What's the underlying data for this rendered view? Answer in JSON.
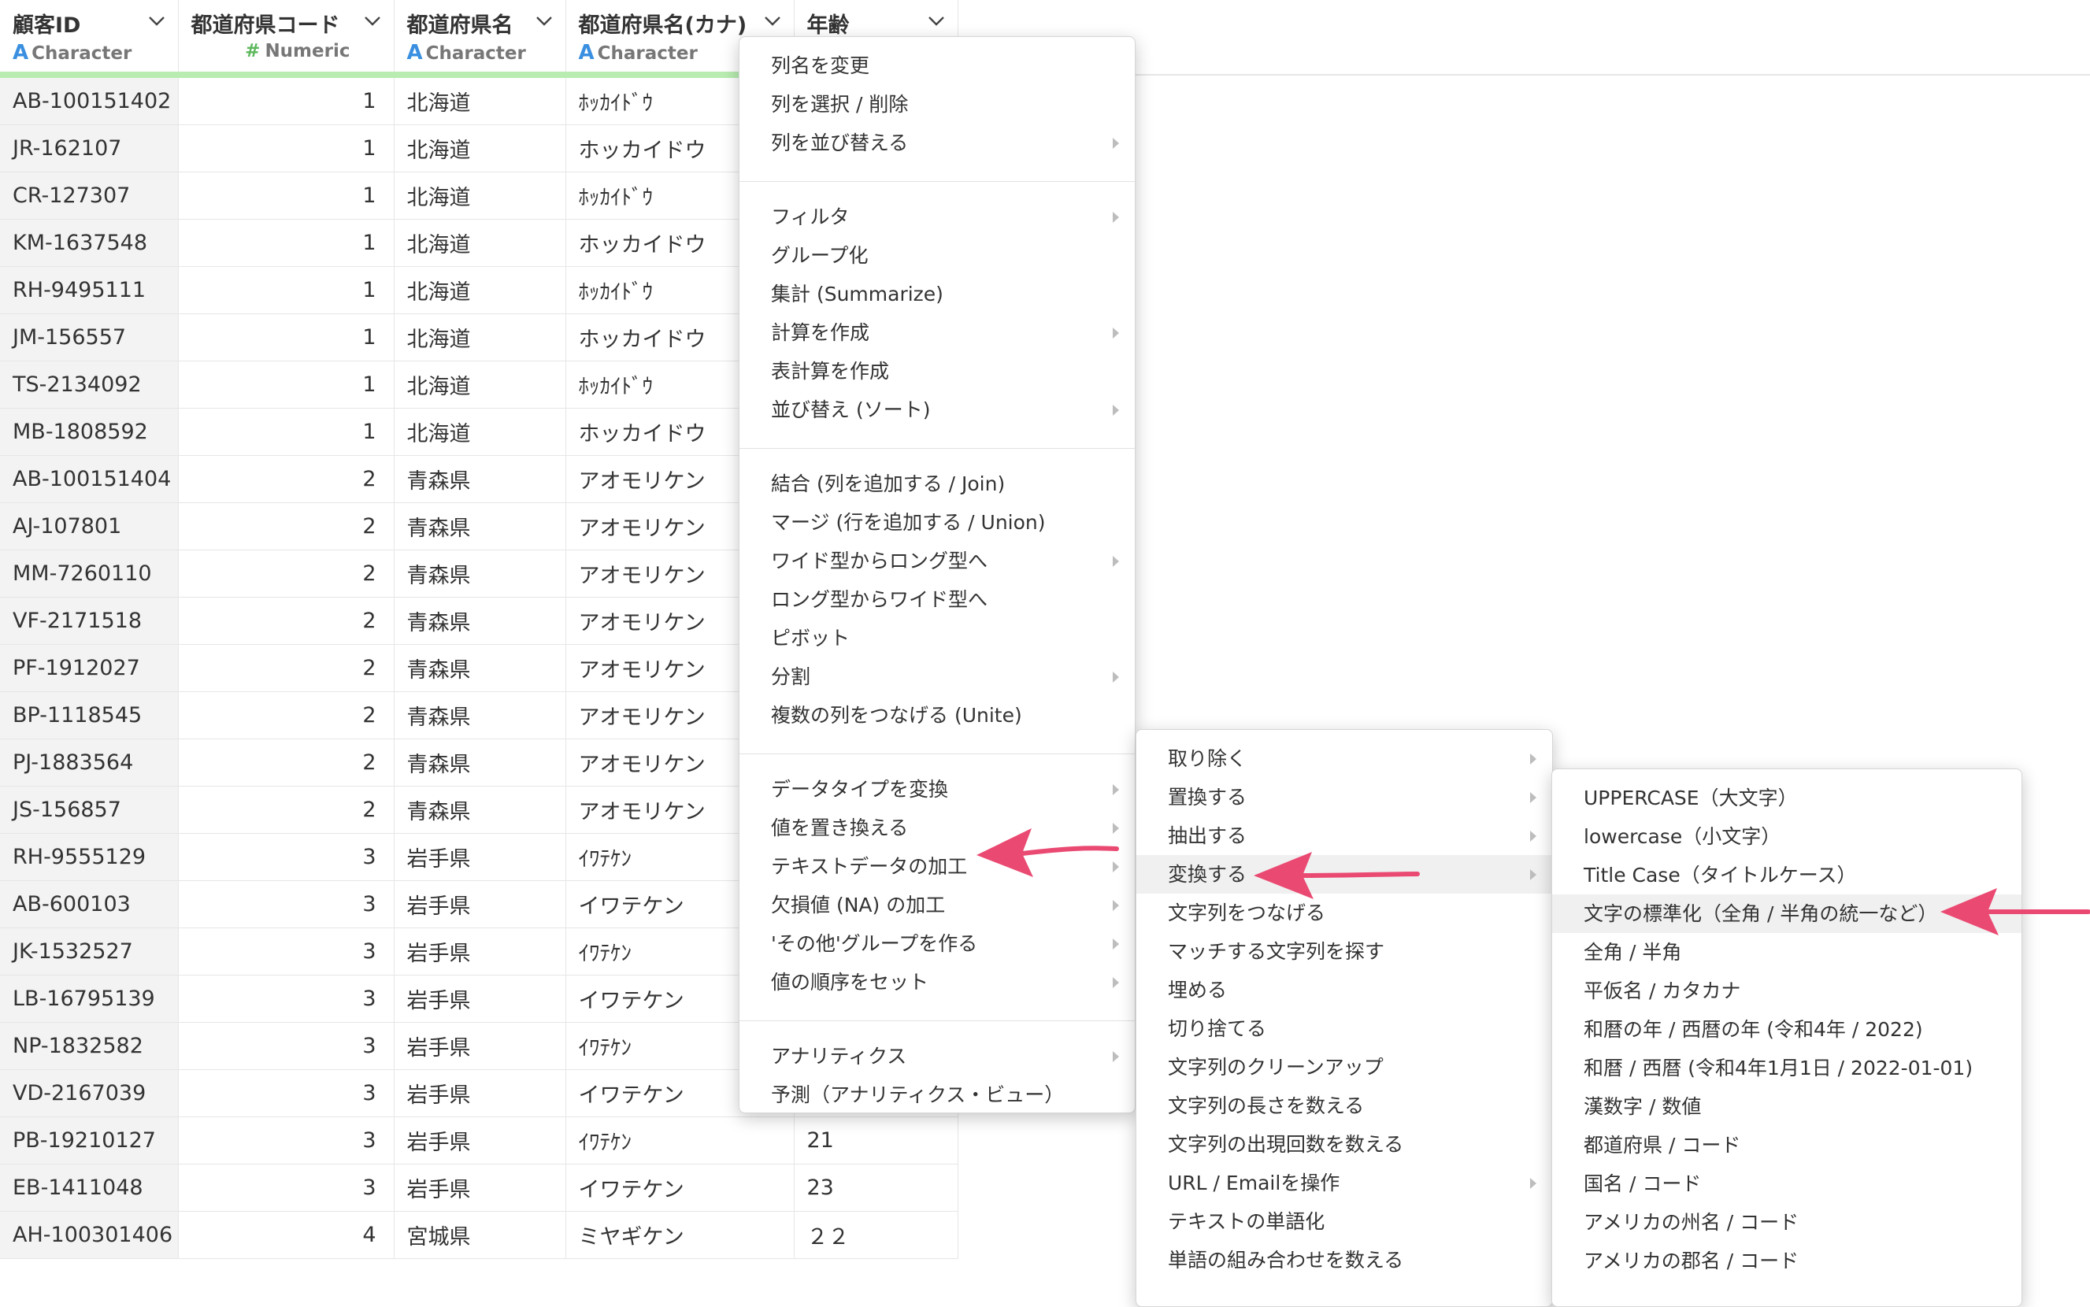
{
  "columns": [
    {
      "name": "顧客ID",
      "type": "Character",
      "type_icon": "A"
    },
    {
      "name": "都道府県コード",
      "type": "Numeric",
      "type_icon": "#"
    },
    {
      "name": "都道府県名",
      "type": "Character",
      "type_icon": "A"
    },
    {
      "name": "都道府県名(カナ)",
      "type": "Character",
      "type_icon": "A"
    },
    {
      "name": "年齢",
      "type": "",
      "type_icon": ""
    }
  ],
  "rows": [
    [
      "AB-100151402",
      "1",
      "北海道",
      "ﾎｯｶｲﾄﾞｳ",
      ""
    ],
    [
      "JR-162107",
      "1",
      "北海道",
      "ホッカイドウ",
      ""
    ],
    [
      "CR-127307",
      "1",
      "北海道",
      "ﾎｯｶｲﾄﾞｳ",
      ""
    ],
    [
      "KM-1637548",
      "1",
      "北海道",
      "ホッカイドウ",
      ""
    ],
    [
      "RH-9495111",
      "1",
      "北海道",
      "ﾎｯｶｲﾄﾞｳ",
      ""
    ],
    [
      "JM-156557",
      "1",
      "北海道",
      "ホッカイドウ",
      ""
    ],
    [
      "TS-2134092",
      "1",
      "北海道",
      "ﾎｯｶｲﾄﾞｳ",
      ""
    ],
    [
      "MB-1808592",
      "1",
      "北海道",
      "ホッカイドウ",
      ""
    ],
    [
      "AB-100151404",
      "2",
      "青森県",
      "アオモリケン",
      ""
    ],
    [
      "AJ-107801",
      "2",
      "青森県",
      "アオモリケン",
      ""
    ],
    [
      "MM-7260110",
      "2",
      "青森県",
      "アオモリケン",
      ""
    ],
    [
      "VF-2171518",
      "2",
      "青森県",
      "アオモリケン",
      ""
    ],
    [
      "PF-1912027",
      "2",
      "青森県",
      "アオモリケン",
      ""
    ],
    [
      "BP-1118545",
      "2",
      "青森県",
      "アオモリケン",
      ""
    ],
    [
      "PJ-1883564",
      "2",
      "青森県",
      "アオモリケン",
      ""
    ],
    [
      "JS-156857",
      "2",
      "青森県",
      "アオモリケン",
      ""
    ],
    [
      "RH-9555129",
      "3",
      "岩手県",
      "ｲﾜﾃｹﾝ",
      ""
    ],
    [
      "AB-600103",
      "3",
      "岩手県",
      "イワテケン",
      ""
    ],
    [
      "JK-1532527",
      "3",
      "岩手県",
      "ｲﾜﾃｹﾝ",
      ""
    ],
    [
      "LB-16795139",
      "3",
      "岩手県",
      "イワテケン",
      ""
    ],
    [
      "NP-1832582",
      "3",
      "岩手県",
      "ｲﾜﾃｹﾝ",
      ""
    ],
    [
      "VD-2167039",
      "3",
      "岩手県",
      "イワテケン",
      ""
    ],
    [
      "PB-19210127",
      "3",
      "岩手県",
      "ｲﾜﾃｹﾝ",
      "21"
    ],
    [
      "EB-1411048",
      "3",
      "岩手県",
      "イワテケン",
      "23"
    ],
    [
      "AH-100301406",
      "4",
      "宮城県",
      "ミヤギケン",
      "２２"
    ]
  ],
  "menu1": {
    "groups": [
      [
        {
          "label": "列名を変更",
          "sub": false
        },
        {
          "label": "列を選択 / 削除",
          "sub": false
        },
        {
          "label": "列を並び替える",
          "sub": true
        }
      ],
      [
        {
          "label": "フィルタ",
          "sub": true
        },
        {
          "label": "グループ化",
          "sub": false
        },
        {
          "label": "集計 (Summarize)",
          "sub": false
        },
        {
          "label": "計算を作成",
          "sub": true
        },
        {
          "label": "表計算を作成",
          "sub": false
        },
        {
          "label": "並び替え (ソート)",
          "sub": true
        }
      ],
      [
        {
          "label": "結合 (列を追加する / Join)",
          "sub": false
        },
        {
          "label": "マージ (行を追加する / Union)",
          "sub": false
        },
        {
          "label": "ワイド型からロング型へ",
          "sub": true
        },
        {
          "label": "ロング型からワイド型へ",
          "sub": false
        },
        {
          "label": "ピボット",
          "sub": false
        },
        {
          "label": "分割",
          "sub": true
        },
        {
          "label": "複数の列をつなげる (Unite)",
          "sub": false
        }
      ],
      [
        {
          "label": "データタイプを変換",
          "sub": true
        },
        {
          "label": "値を置き換える",
          "sub": true
        },
        {
          "label": "テキストデータの加工",
          "sub": true
        },
        {
          "label": "欠損値 (NA) の加工",
          "sub": true
        },
        {
          "label": "'その他'グループを作る",
          "sub": true
        },
        {
          "label": "値の順序をセット",
          "sub": true
        }
      ],
      [
        {
          "label": "アナリティクス",
          "sub": true
        },
        {
          "label": "予測（アナリティクス・ビュー）",
          "sub": false
        }
      ]
    ]
  },
  "menu2": {
    "items": [
      {
        "label": "取り除く",
        "sub": true
      },
      {
        "label": "置換する",
        "sub": true
      },
      {
        "label": "抽出する",
        "sub": true
      },
      {
        "label": "変換する",
        "sub": true,
        "highlight": true
      },
      {
        "label": "文字列をつなげる",
        "sub": false
      },
      {
        "label": "マッチする文字列を探す",
        "sub": false
      },
      {
        "label": "埋める",
        "sub": false
      },
      {
        "label": "切り捨てる",
        "sub": false
      },
      {
        "label": "文字列のクリーンアップ",
        "sub": false
      },
      {
        "label": "文字列の長さを数える",
        "sub": false
      },
      {
        "label": "文字列の出現回数を数える",
        "sub": false
      },
      {
        "label": "URL / Emailを操作",
        "sub": true
      },
      {
        "label": "テキストの単語化",
        "sub": false
      },
      {
        "label": "単語の組み合わせを数える",
        "sub": false
      }
    ]
  },
  "menu3": {
    "items": [
      {
        "label": "UPPERCASE（大文字）",
        "highlight": false
      },
      {
        "label": "lowercase（小文字）",
        "highlight": false
      },
      {
        "label": "Title Case（タイトルケース）",
        "highlight": false
      },
      {
        "label": "文字の標準化（全角 / 半角の統一など）",
        "highlight": true
      },
      {
        "label": "全角 / 半角",
        "highlight": false
      },
      {
        "label": "平仮名 / カタカナ",
        "highlight": false
      },
      {
        "label": "和暦の年 / 西暦の年 (令和4年 / 2022)",
        "highlight": false
      },
      {
        "label": "和暦 / 西暦 (令和4年1月1日 / 2022-01-01)",
        "highlight": false
      },
      {
        "label": "漢数字 / 数値",
        "highlight": false
      },
      {
        "label": "都道府県 / コード",
        "highlight": false
      },
      {
        "label": "国名 / コード",
        "highlight": false
      },
      {
        "label": "アメリカの州名 / コード",
        "highlight": false
      },
      {
        "label": "アメリカの郡名 / コード",
        "highlight": false
      }
    ]
  },
  "colors": {
    "arrow": "#ea4a72",
    "header_underline": "#b8ecb0",
    "type_char": "#3a8fe0",
    "type_num": "#5cb85c"
  }
}
